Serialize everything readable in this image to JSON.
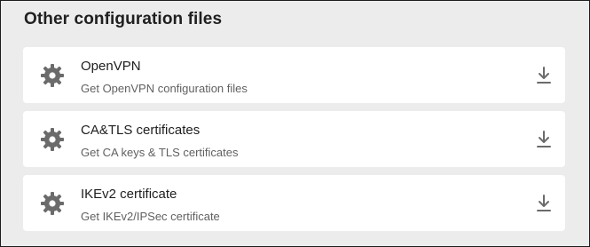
{
  "section": {
    "title": "Other configuration files"
  },
  "items": [
    {
      "title": "OpenVPN",
      "description": "Get OpenVPN configuration files",
      "icon": "gear-icon",
      "action_icon": "download-icon"
    },
    {
      "title": "CA&TLS certificates",
      "description": "Get CA keys & TLS certificates",
      "icon": "gear-icon",
      "action_icon": "download-icon"
    },
    {
      "title": "IKEv2 certificate",
      "description": "Get IKEv2/IPSec certificate",
      "icon": "gear-icon",
      "action_icon": "download-icon"
    }
  ],
  "colors": {
    "background": "#ececec",
    "card": "#ffffff",
    "icon": "#6b6b6b",
    "title": "#1e1e1e",
    "description": "#616161"
  }
}
